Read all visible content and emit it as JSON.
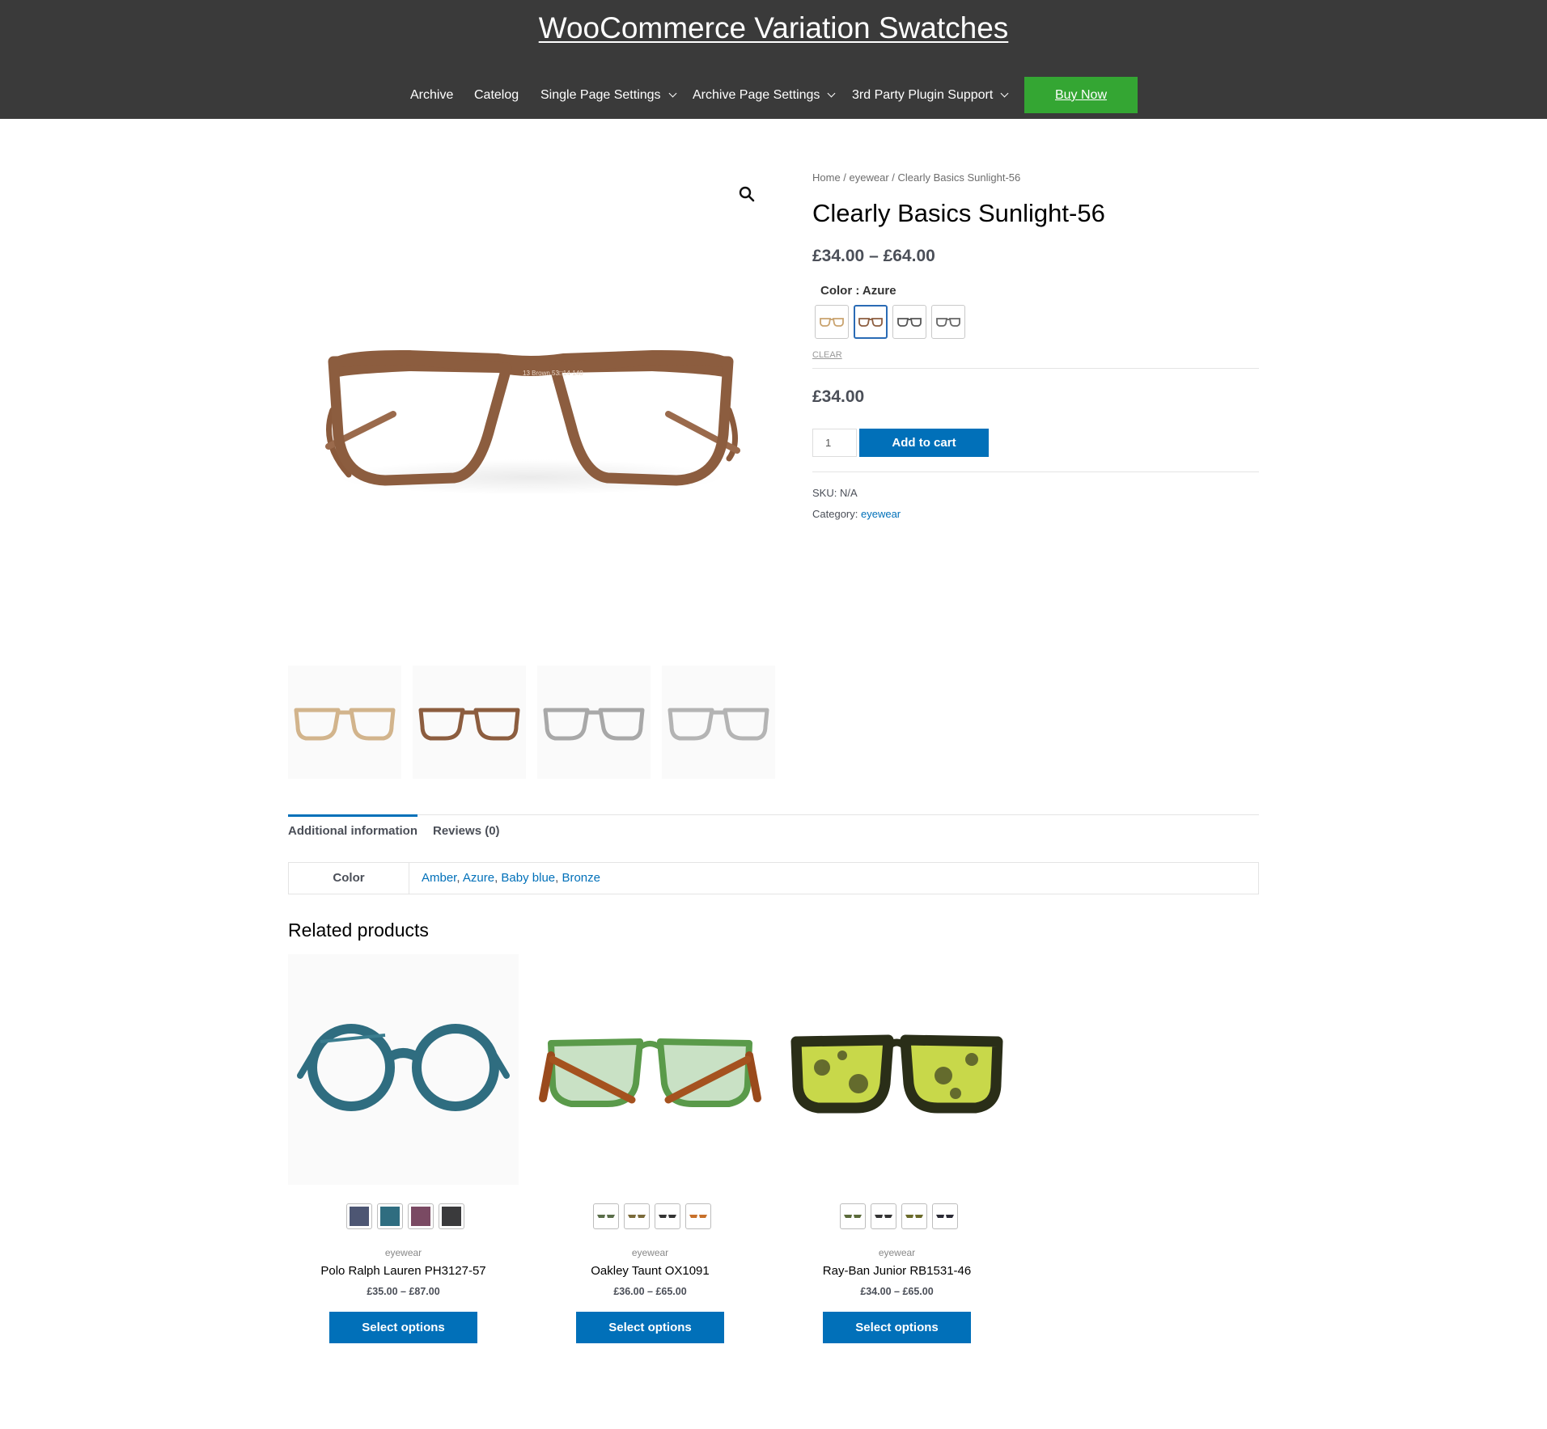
{
  "header": {
    "site_title": "WooCommerce Variation Swatches",
    "nav": [
      "Archive",
      "Catelog",
      "Single Page Settings",
      "Archive Page Settings",
      "3rd Party Plugin Support"
    ],
    "buy_now": "Buy Now"
  },
  "breadcrumb": {
    "home": "Home",
    "sep1": " / ",
    "cat": "eyewear",
    "sep2": " / ",
    "current": "Clearly Basics Sunlight-56"
  },
  "product": {
    "title": "Clearly Basics Sunlight-56",
    "price_range": "£34.00 – £64.00",
    "color_label": "Color : Azure",
    "swatch_colors": [
      "Amber",
      "Azure",
      "Baby blue",
      "Bronze"
    ],
    "selected_swatch": "Azure",
    "clear": "CLEAR",
    "price": "£34.00",
    "quantity": "1",
    "add_to_cart": "Add to cart",
    "sku_label": "SKU:",
    "sku_value": "N/A",
    "category_label": "Category:",
    "category_value": "eyewear"
  },
  "tabs": {
    "additional": "Additional information",
    "reviews": "Reviews (0)"
  },
  "attributes": {
    "label": "Color",
    "values": [
      "Amber",
      "Azure",
      "Baby blue",
      "Bronze"
    ],
    "sep": ", "
  },
  "related": {
    "title": "Related products",
    "products": [
      {
        "category": "eyewear",
        "name": "Polo Ralph Lauren PH3127-57",
        "price": "£35.00 – £87.00",
        "button": "Select options",
        "swatch_colors": [
          "#4d5673",
          "#2f6d80",
          "#7a4a63",
          "#3a3a3c"
        ]
      },
      {
        "category": "eyewear",
        "name": "Oakley Taunt OX1091",
        "price": "£36.00 – £65.00",
        "button": "Select options"
      },
      {
        "category": "eyewear",
        "name": "Ray-Ban Junior RB1531-46",
        "price": "£34.00 – £65.00",
        "button": "Select options"
      }
    ]
  },
  "colors": {
    "header_bg": "#3a3a3a",
    "buy_now_bg": "#34a633",
    "accent": "#0170b9"
  }
}
